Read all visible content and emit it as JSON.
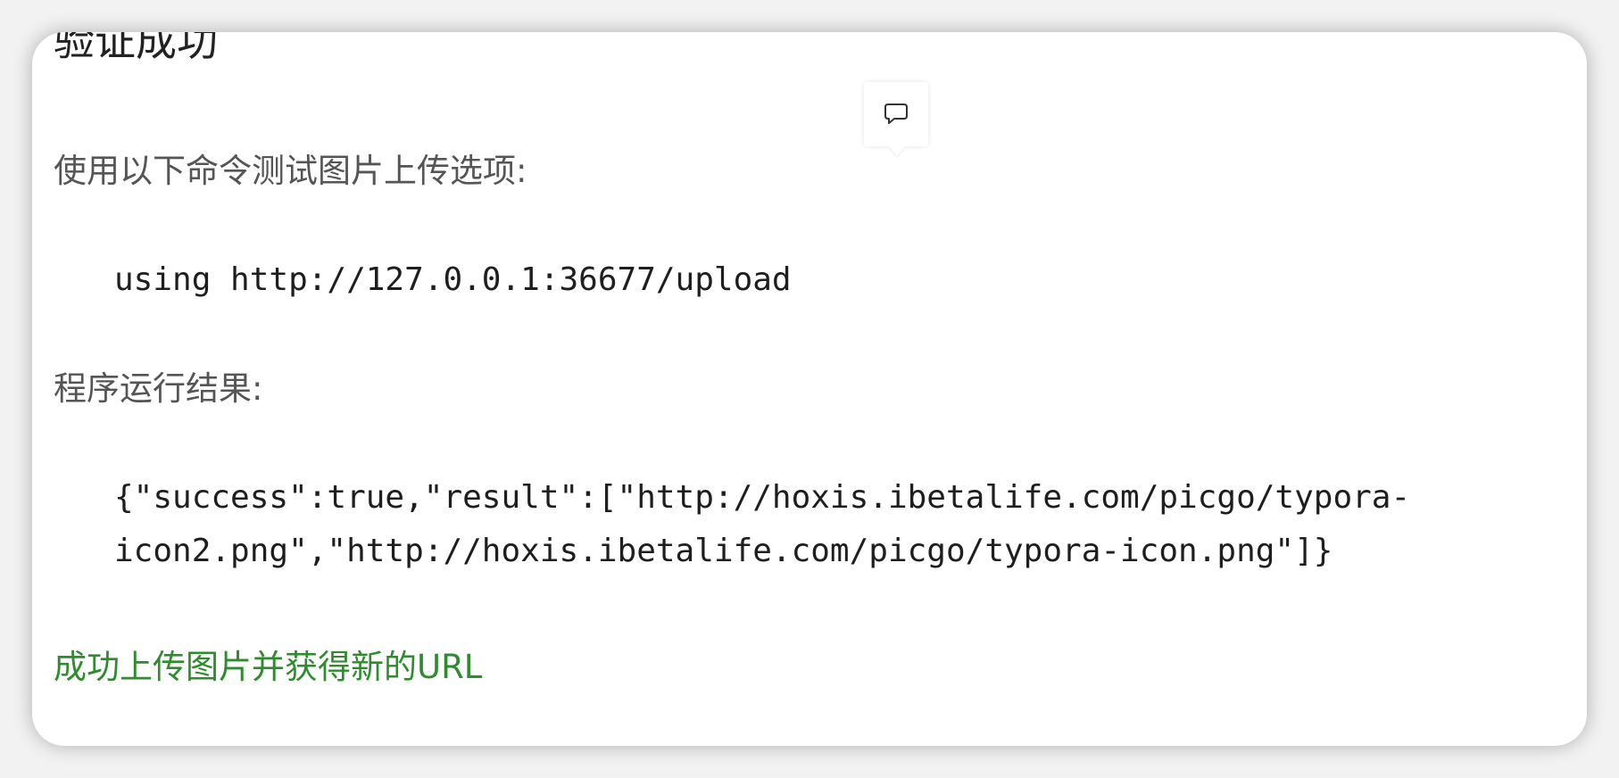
{
  "doc": {
    "heading": "验证成功",
    "intro": "使用以下命令测试图片上传选项:",
    "command": "using http://127.0.0.1:36677/upload",
    "result_label": "程序运行结果:",
    "result_lines": [
      "{\"success\":true,\"result\":[\"http://hoxis.ibetalife.com/picgo/typora-",
      "icon2.png\",\"http://hoxis.ibetalife.com/picgo/typora-icon.png\"]}"
    ],
    "success_message": "成功上传图片并获得新的URL"
  },
  "toolbar": {
    "comment_icon": "comment-icon"
  },
  "colors": {
    "success_text": "#2e8b2e",
    "body_text": "#555555",
    "code_text": "#1e1e1e"
  }
}
